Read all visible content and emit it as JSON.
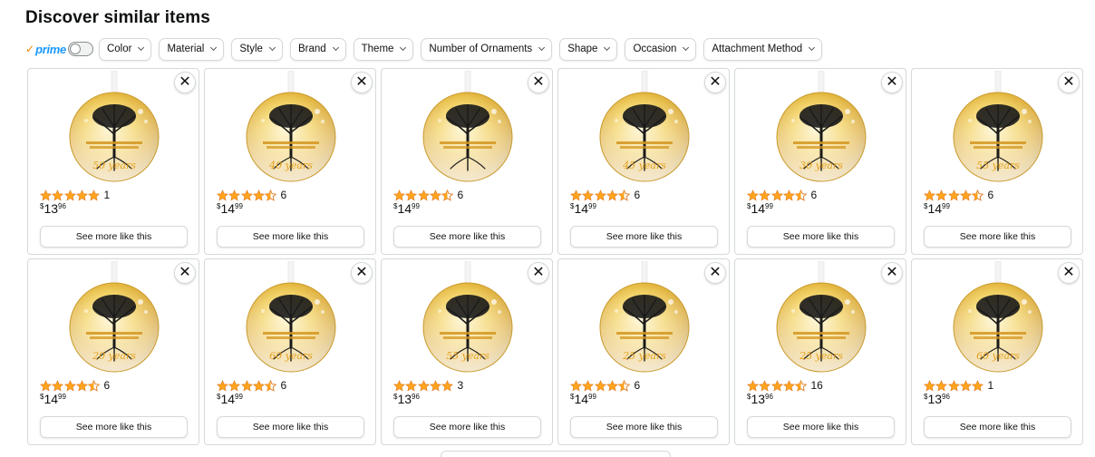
{
  "title": "Discover similar items",
  "prime": {
    "check": "✓",
    "label": "prime"
  },
  "filters": [
    "Color",
    "Material",
    "Style",
    "Brand",
    "Theme",
    "Number of Ornaments",
    "Shape",
    "Occasion",
    "Attachment Method"
  ],
  "items": [
    {
      "year": "50 years",
      "rating": 5,
      "reviews": "1",
      "price": {
        "symbol": "$",
        "whole": "13",
        "cents": "96"
      },
      "action": "See more like this"
    },
    {
      "year": "40 years",
      "rating": 4.5,
      "reviews": "6",
      "price": {
        "symbol": "$",
        "whole": "14",
        "cents": "99"
      },
      "action": "See more like this"
    },
    {
      "year": "",
      "rating": 4.5,
      "reviews": "6",
      "price": {
        "symbol": "$",
        "whole": "14",
        "cents": "99"
      },
      "action": "See more like this"
    },
    {
      "year": "45 years",
      "rating": 4.5,
      "reviews": "6",
      "price": {
        "symbol": "$",
        "whole": "14",
        "cents": "99"
      },
      "action": "See more like this"
    },
    {
      "year": "30 years",
      "rating": 4.5,
      "reviews": "6",
      "price": {
        "symbol": "$",
        "whole": "14",
        "cents": "99"
      },
      "action": "See more like this"
    },
    {
      "year": "55 years",
      "rating": 4.5,
      "reviews": "6",
      "price": {
        "symbol": "$",
        "whole": "14",
        "cents": "99"
      },
      "action": "See more like this"
    },
    {
      "year": "20 years",
      "rating": 4.5,
      "reviews": "6",
      "price": {
        "symbol": "$",
        "whole": "14",
        "cents": "99"
      },
      "action": "See more like this"
    },
    {
      "year": "60 years",
      "rating": 4.5,
      "reviews": "6",
      "price": {
        "symbol": "$",
        "whole": "14",
        "cents": "99"
      },
      "action": "See more like this"
    },
    {
      "year": "55 years",
      "rating": 5,
      "reviews": "3",
      "price": {
        "symbol": "$",
        "whole": "13",
        "cents": "96"
      },
      "action": "See more like this"
    },
    {
      "year": "25 years",
      "rating": 4.5,
      "reviews": "6",
      "price": {
        "symbol": "$",
        "whole": "14",
        "cents": "99"
      },
      "action": "See more like this"
    },
    {
      "year": "25 years",
      "rating": 4.5,
      "reviews": "16",
      "price": {
        "symbol": "$",
        "whole": "13",
        "cents": "96"
      },
      "action": "See more like this"
    },
    {
      "year": "60 years",
      "rating": 5,
      "reviews": "1",
      "price": {
        "symbol": "$",
        "whole": "13",
        "cents": "96"
      },
      "action": "See more like this"
    }
  ],
  "colors": {
    "star": "#ffa41c",
    "prime_blue": "#1a98ff",
    "prime_check": "#f08804",
    "gold": "#e8b832"
  },
  "icons": {
    "close": "close-icon",
    "chevron": "chevron-down-icon",
    "star": "star-icon",
    "ornament": "tree-of-life-ornament-image"
  }
}
